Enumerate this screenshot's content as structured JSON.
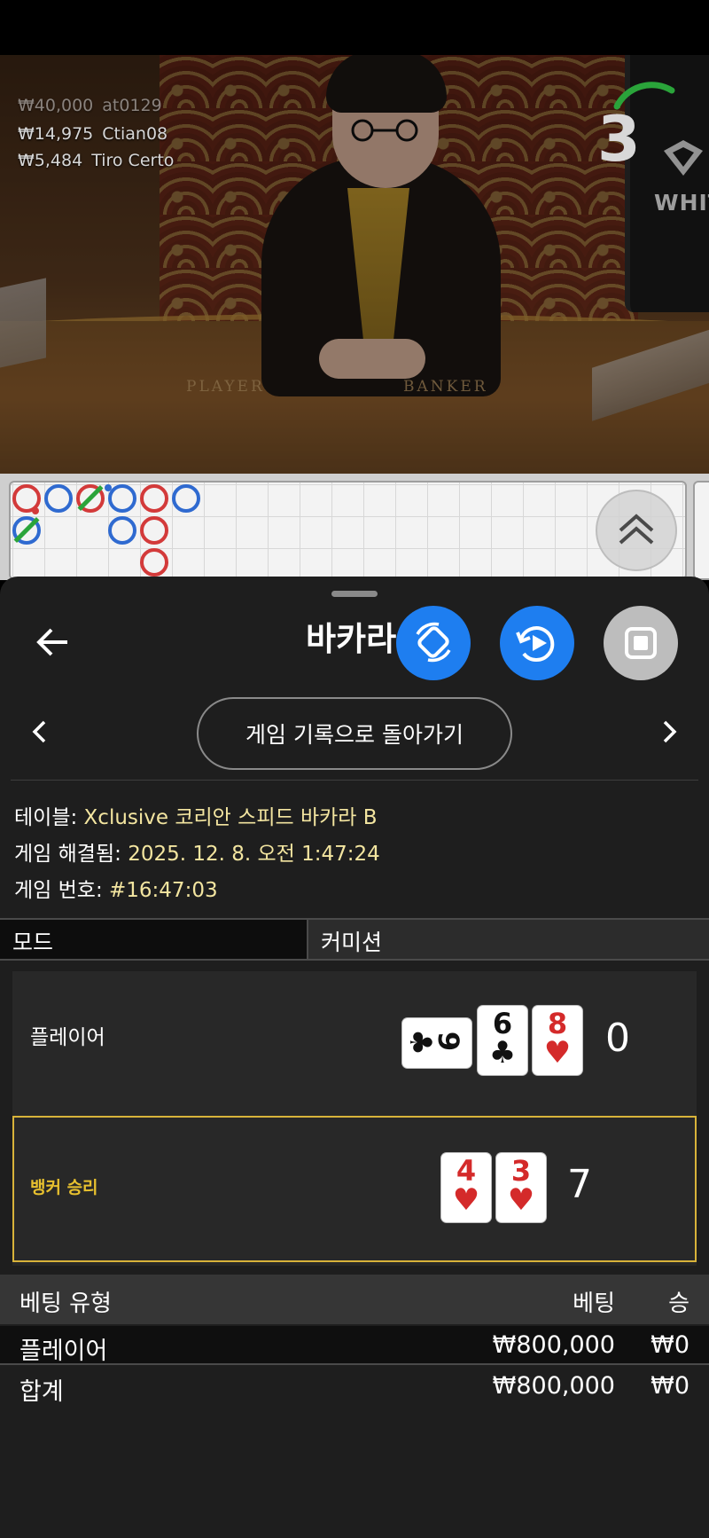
{
  "video": {
    "recent_winners": [
      {
        "amount": "₩40,000",
        "name": "at0129"
      },
      {
        "amount": "₩14,975",
        "name": "Ctian08"
      },
      {
        "amount": "₩5,484",
        "name": "Tiro Certo"
      }
    ],
    "countdown": "3",
    "table_label_player": "PLAYER",
    "table_label_banker": "BANKER",
    "monitor_text": "WHITE"
  },
  "roadmap": {
    "colors": {
      "banker": "#d33a3a",
      "player": "#2f6ad0",
      "tie": "#2aa43a"
    }
  },
  "sheet": {
    "title": "바카라",
    "back_to_history_label": "게임 기록으로 돌아가기",
    "info": {
      "table_label": "테이블:",
      "table_value": "Xclusive 코리안 스피드 바카라 B",
      "resolved_label": "게임 해결됨:",
      "resolved_value": "2025. 12. 8. 오전 1:47:24",
      "number_label": "게임 번호:",
      "number_value": "#16:47:03"
    },
    "mode_label": "모드",
    "commission_label": "커미션",
    "result": {
      "player_label": "플레이어",
      "player_cards": [
        {
          "rank": "9",
          "suit": "♣",
          "color": "black",
          "orientation": "sideways"
        },
        {
          "rank": "6",
          "suit": "♣",
          "color": "black"
        },
        {
          "rank": "8",
          "suit": "♥",
          "color": "red"
        }
      ],
      "player_score": "0",
      "banker_label": "뱅커 승리",
      "banker_cards": [
        {
          "rank": "4",
          "suit": "♥",
          "color": "red"
        },
        {
          "rank": "3",
          "suit": "♥",
          "color": "red"
        }
      ],
      "banker_score": "7",
      "banker_highlight_color": "#d8b33a"
    },
    "bets": {
      "header": {
        "type": "베팅 유형",
        "bet": "베팅",
        "win": "승"
      },
      "rows": [
        {
          "type": "플레이어",
          "bet": "₩800,000",
          "win": "₩0"
        }
      ],
      "total": {
        "type": "합계",
        "bet": "₩800,000",
        "win": "₩0"
      }
    }
  }
}
